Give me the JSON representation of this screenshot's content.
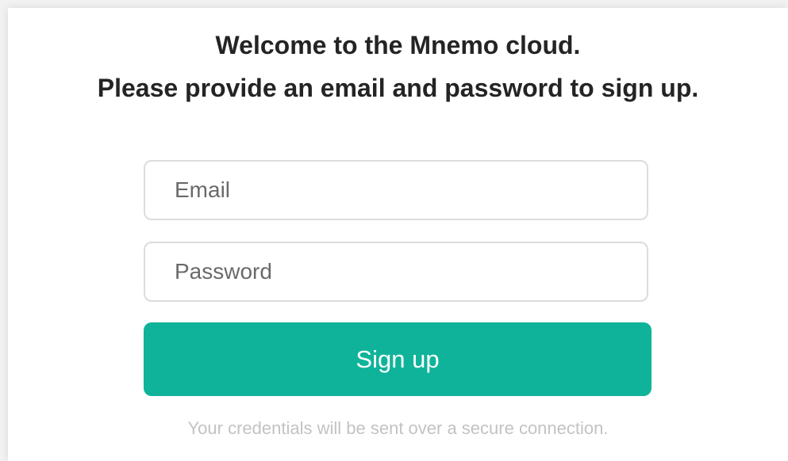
{
  "header": {
    "line1": "Welcome to the Mnemo cloud.",
    "line2": "Please provide an email and password to sign up."
  },
  "form": {
    "email": {
      "placeholder": "Email",
      "value": ""
    },
    "password": {
      "placeholder": "Password",
      "value": ""
    },
    "submit_label": "Sign up"
  },
  "footer": {
    "security_note": "Your credentials will be sent over a secure connection."
  },
  "colors": {
    "accent": "#0fb39a",
    "heading_text": "#242424",
    "note_text": "#c3c3c3",
    "field_border": "#dcdcdc"
  }
}
